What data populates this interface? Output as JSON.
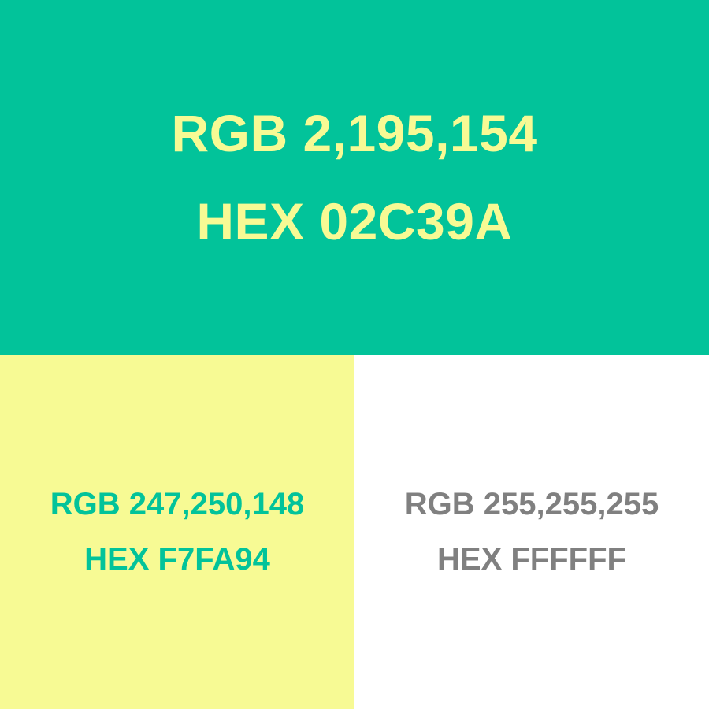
{
  "swatches": [
    {
      "rgb_label": "RGB 2,195,154",
      "hex_label": "HEX 02C39A",
      "background": "#02C39A",
      "text_color": "#F7FA94"
    },
    {
      "rgb_label": "RGB 247,250,148",
      "hex_label": "HEX F7FA94",
      "background": "#F7FA94",
      "text_color": "#02C39A"
    },
    {
      "rgb_label": "RGB 255,255,255",
      "hex_label": "HEX FFFFFF",
      "background": "#FFFFFF",
      "text_color": "#808080"
    }
  ]
}
